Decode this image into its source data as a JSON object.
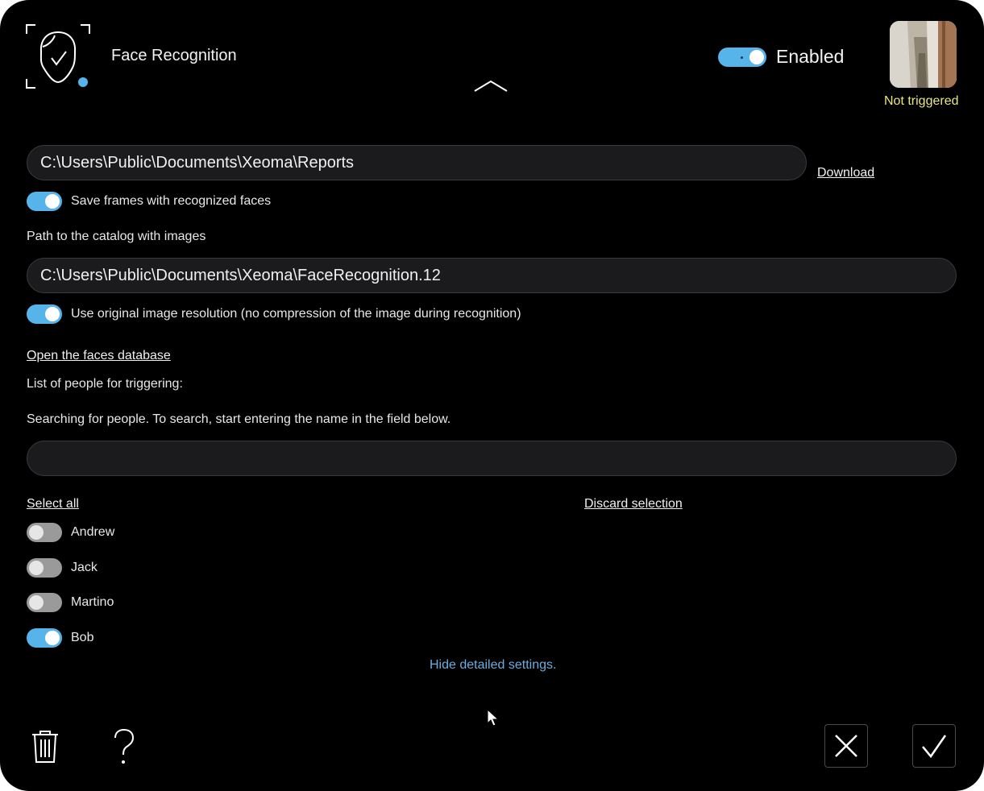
{
  "header": {
    "title": "Face Recognition",
    "enabled_label": "Enabled",
    "enabled": true,
    "trigger_status": "Not triggered",
    "face_icon": "face-recognition-icon",
    "collapse_icon": "chevron-up-icon"
  },
  "reports": {
    "path_value": "C:\\Users\\Public\\Documents\\Xeoma\\Reports",
    "download_label": "Download"
  },
  "save_frames": {
    "label": "Save frames with recognized faces",
    "checked": true
  },
  "catalog": {
    "label": "Path to the catalog with images",
    "path_value": "C:\\Users\\Public\\Documents\\Xeoma\\FaceRecognition.12"
  },
  "original_resolution": {
    "label": "Use original image resolution (no compression of the image during recognition)",
    "checked": true
  },
  "faces_db_link": "Open the faces database",
  "people_list_label": "List of people for triggering:",
  "search_hint": "Searching for people. To search, start entering the name in the field below.",
  "search": {
    "value": ""
  },
  "select_all_label": "Select all",
  "discard_selection_label": "Discard selection",
  "people": [
    {
      "name": "Andrew",
      "checked": false
    },
    {
      "name": "Jack",
      "checked": false
    },
    {
      "name": "Martino",
      "checked": false
    },
    {
      "name": "Bob",
      "checked": true
    }
  ],
  "hide_settings_label": "Hide detailed settings.",
  "footer": {
    "delete_icon": "trash-icon",
    "help_icon": "question-icon",
    "cancel_icon": "close-icon",
    "ok_icon": "checkmark-icon"
  },
  "colors": {
    "accent": "#56b4ea",
    "background": "#000000",
    "status_yellow": "#e8e87a",
    "link_blue": "#6aaee0"
  }
}
